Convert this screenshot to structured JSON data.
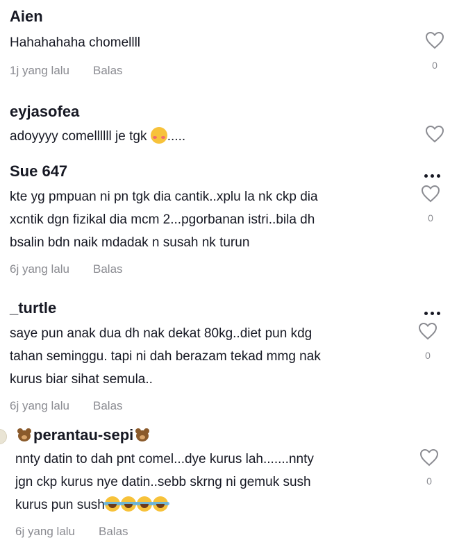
{
  "comments": [
    {
      "username": "Aien",
      "lines": [
        "Hahahahaha chomellll"
      ],
      "time": "1j yang lalu",
      "reply": "Balas",
      "likes": "0",
      "has_more": false
    },
    {
      "username": "eyjasofea",
      "lines": [
        "adoyyyy comellllll je tgk",
        "....."
      ],
      "time": "",
      "reply": "",
      "likes": "",
      "has_more": false
    },
    {
      "username": "Sue 647",
      "lines": [
        "kte yg pmpuan ni pn tgk dia cantik..xplu la nk ckp dia",
        "xcntik dgn fizikal dia mcm 2...pgorbanan istri..bila dh",
        "bsalin bdn naik mdadak n susah nk turun"
      ],
      "time": "6j yang lalu",
      "reply": "Balas",
      "likes": "0",
      "has_more": true
    },
    {
      "username": "_turtle",
      "lines": [
        "saye pun anak dua dh nak dekat 80kg..diet pun kdg",
        "tahan seminggu. tapi ni dah berazam tekad mmg nak",
        "kurus biar sihat semula.."
      ],
      "time": "6j yang lalu",
      "reply": "Balas",
      "likes": "0",
      "has_more": true
    },
    {
      "username": "perantau-sepi",
      "lines": [
        "nnty datin to dah pnt comel...dye kurus lah.......nnty",
        "jgn ckp kurus nye datin..sebb skrng ni gemuk sush",
        "kurus pun sush"
      ],
      "time": "6j yang lalu",
      "reply": "Balas",
      "likes": "0",
      "has_more": false
    }
  ],
  "icons": {
    "like": "heart-outline-icon",
    "more": "more-horizontal-icon",
    "username_decoration": "bear-face-emoji",
    "blush": "smiling-face-with-hearts-emoji",
    "laugh": "face-with-tears-of-joy-emoji"
  },
  "colors": {
    "text": "#161823",
    "muted": "#8a8b91",
    "icon": "#8a8b91"
  }
}
